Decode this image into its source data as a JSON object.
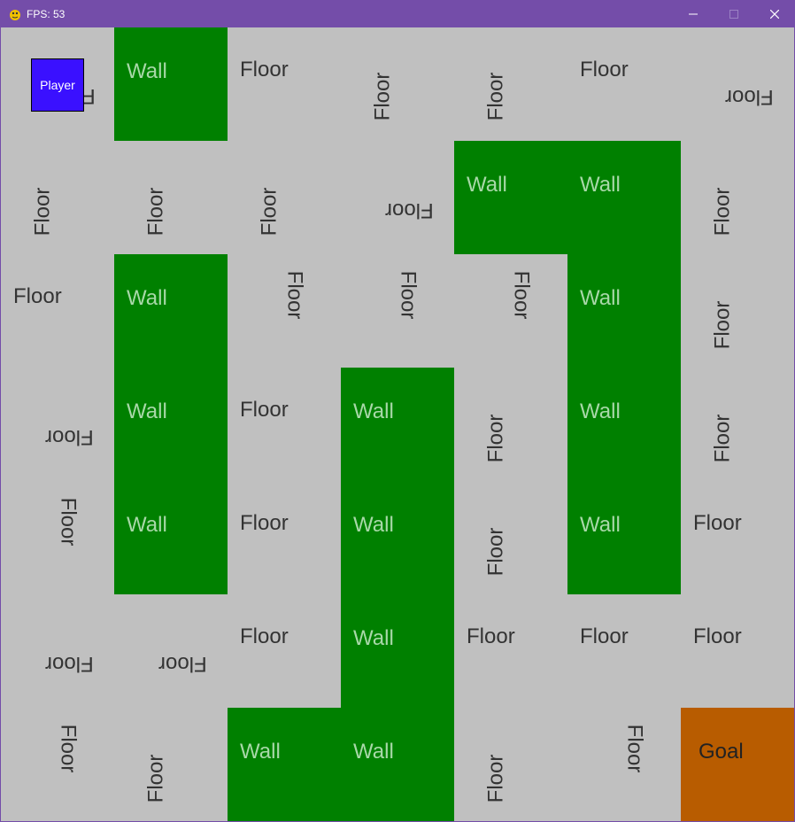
{
  "window": {
    "title": "FPS: 53",
    "app_icon": "pygame-snake-icon",
    "controls": [
      "minimize-icon",
      "maximize-icon",
      "close-icon"
    ]
  },
  "colors": {
    "titlebar": "#744da9",
    "floor": "#c0c0c0",
    "wall": "#008000",
    "goal": "#b85c00",
    "player": "#3a10ff"
  },
  "labels": {
    "floor": "Floor",
    "wall": "Wall",
    "goal": "Goal",
    "player": "Player"
  },
  "grid": [
    [
      "Floor",
      "Wall",
      "Floor",
      "Floor",
      "Floor",
      "Floor",
      "Floor"
    ],
    [
      "Floor",
      "Floor",
      "Floor",
      "Floor",
      "Wall",
      "Wall",
      "Floor"
    ],
    [
      "Floor",
      "Wall",
      "Floor",
      "Floor",
      "Floor",
      "Wall",
      "Floor"
    ],
    [
      "Floor",
      "Wall",
      "Floor",
      "Wall",
      "Floor",
      "Wall",
      "Floor"
    ],
    [
      "Floor",
      "Wall",
      "Floor",
      "Wall",
      "Floor",
      "Wall",
      "Floor"
    ],
    [
      "Floor",
      "Floor",
      "Floor",
      "Wall",
      "Floor",
      "Floor",
      "Floor"
    ],
    [
      "Floor",
      "Floor",
      "Wall",
      "Wall",
      "Floor",
      "Floor",
      "Goal"
    ]
  ],
  "player_cell": {
    "row": 0,
    "col": 0
  }
}
